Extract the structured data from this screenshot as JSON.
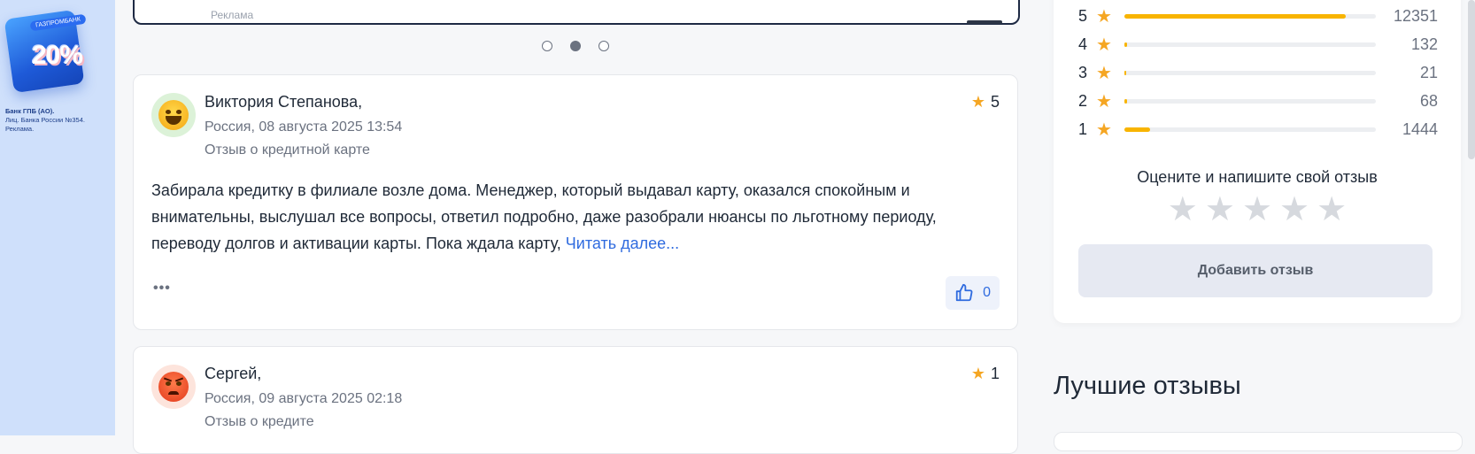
{
  "banner": {
    "tag": "ГАЗПРОМБАНК",
    "percent": "20%",
    "bank": "Банк ГПБ (АО).",
    "license": "Лиц. Банка России №354.",
    "ad": "Реклама."
  },
  "carousel": {
    "ad_label": "Реклама",
    "dots": 3,
    "active_dot": 2
  },
  "reviews": [
    {
      "author": "Виктория Степанова,",
      "date": "Россия, 08 августа 2025 13:54",
      "kind": "Отзыв о кредитной карте",
      "rating": "5",
      "text": "Забирала кредитку в филиале возле дома. Менеджер, который выдавал карту, оказался спокойным и внимательны, выслушал все вопросы, ответил подробно, даже разобрали нюансы по льготному периоду, переводу долгов и активации карты. Пока ждала карту, ",
      "read_more": "Читать далее...",
      "more": "•••",
      "likes": "0"
    },
    {
      "author": "Сергей,",
      "date": "Россия, 09 августа 2025 02:18",
      "kind": "Отзыв о кредите",
      "rating": "1"
    }
  ],
  "stats": {
    "rows": [
      {
        "stars": "5",
        "count": "12351",
        "fraction": 0.88
      },
      {
        "stars": "4",
        "count": "132",
        "fraction": 0.012
      },
      {
        "stars": "3",
        "count": "21",
        "fraction": 0.008
      },
      {
        "stars": "2",
        "count": "68",
        "fraction": 0.009
      },
      {
        "stars": "1",
        "count": "1444",
        "fraction": 0.103
      }
    ],
    "prompt": "Оцените и напишите свой отзыв",
    "add_button": "Добавить отзыв"
  },
  "best": {
    "title": "Лучшие отзывы"
  },
  "colors": {
    "accent": "#f5a623",
    "link": "#2f6bdf",
    "bar": "#f8b400"
  }
}
